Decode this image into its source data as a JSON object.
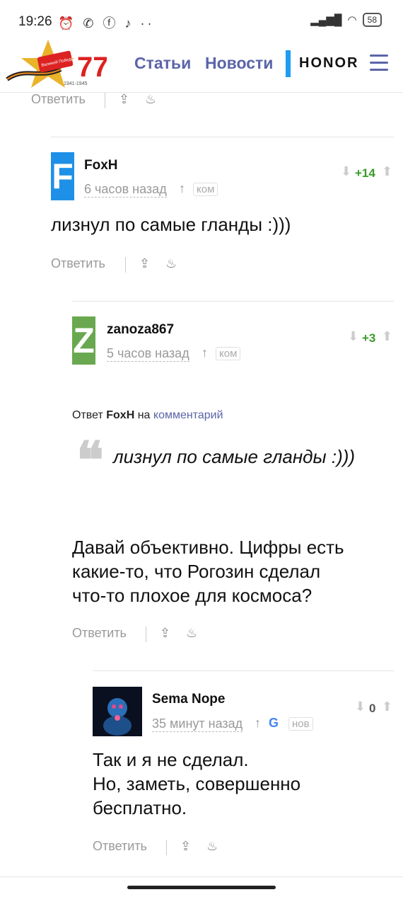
{
  "status_bar": {
    "time": "19:26",
    "icons": "⏰ ✆ ⓕ ♪ ··",
    "battery": "58"
  },
  "header": {
    "logo_text_top": "Великой Победы!",
    "logo_number": "77",
    "logo_years": "1941-1945",
    "nav": [
      "Статьи",
      "Новости"
    ],
    "brand": "HONOR"
  },
  "colors": {
    "accent": "#5b64a8",
    "vote_green": "#3a9a2a",
    "foxh_blue": "#1e90e8",
    "zanoza_green": "#6aa84f"
  },
  "top_actions": {
    "reply": "Ответить"
  },
  "comments": [
    {
      "author": "FoxH",
      "avatar_letter": "F",
      "time": "6 часов назад",
      "tag": "ком",
      "vote": "+14",
      "text": "лизнул по самые гланды :)))",
      "reply": "Ответить"
    },
    {
      "author": "zanoza867",
      "avatar_letter": "Z",
      "time": "5 часов назад",
      "tag": "ком",
      "vote": "+3",
      "quote_prefix": "Ответ",
      "quote_author": "FoxH",
      "quote_mid": "на",
      "quote_link": "комментарий",
      "quote_text": "лизнул по самые гланды :)))",
      "text_lines": [
        "Давай объективно. Цифры есть",
        "какие-то, что Рогозин сделал",
        "что-то плохое для космоса?"
      ],
      "reply": "Ответить"
    },
    {
      "author": "Sema Nope",
      "time": "35 минут назад",
      "tag": "нов",
      "vote": "0",
      "text_lines": [
        "Так и я не сделал.",
        "Но, заметь, совершенно",
        "бесплатно."
      ],
      "reply": "Ответить"
    }
  ]
}
